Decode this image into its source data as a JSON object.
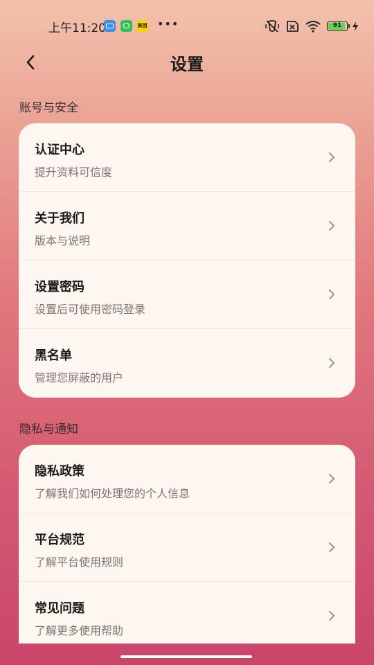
{
  "status_bar": {
    "time": "上午11:20",
    "app_badges": [
      "mail-app-icon",
      "frog-app-icon",
      "meituan-app-icon"
    ],
    "meituan_label": "美团",
    "more": "•••",
    "battery_level": "91",
    "battery_color": "#5cd64e"
  },
  "header": {
    "title": "设置"
  },
  "sections": [
    {
      "title": "账号与安全",
      "items": [
        {
          "title": "认证中心",
          "subtitle": "提升资料可信度"
        },
        {
          "title": "关于我们",
          "subtitle": "版本与说明"
        },
        {
          "title": "设置密码",
          "subtitle": "设置后可使用密码登录"
        },
        {
          "title": "黑名单",
          "subtitle": "管理您屏蔽的用户"
        }
      ]
    },
    {
      "title": "隐私与通知",
      "items": [
        {
          "title": "隐私政策",
          "subtitle": "了解我们如何处理您的个人信息"
        },
        {
          "title": "平台规范",
          "subtitle": "了解平台使用规则"
        },
        {
          "title": "常见问题",
          "subtitle": "了解更多使用帮助"
        }
      ]
    }
  ]
}
